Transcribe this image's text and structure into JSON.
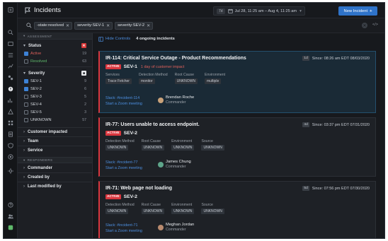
{
  "header": {
    "title": "Incidents",
    "date_badge": "7d",
    "date_range": "Jul 28, 11:25 am – Aug 4, 11:25 am",
    "new_button": "New Incident"
  },
  "search": {
    "query_chips": [
      "-state:resolved",
      "severity:SEV-1",
      "severity:SEV-2"
    ],
    "code_icon_text": "</>"
  },
  "filters": {
    "assessment_header": "ASSESSMENT",
    "status_title": "Status",
    "status_options": [
      {
        "label": "Active",
        "count": "19",
        "checked": true
      },
      {
        "label": "Resolved",
        "count": "63",
        "checked": false
      }
    ],
    "severity_title": "Severity",
    "severity_options": [
      {
        "label": "SEV-1",
        "count": "9",
        "checked": true
      },
      {
        "label": "SEV-2",
        "count": "6",
        "checked": true
      },
      {
        "label": "SEV-3",
        "count": "5",
        "checked": false
      },
      {
        "label": "SEV-4",
        "count": "2",
        "checked": false
      },
      {
        "label": "SEV-5",
        "count": "3",
        "checked": false
      },
      {
        "label": "UNKNOWN",
        "count": "57",
        "checked": false
      }
    ],
    "collapsed_sections": [
      "Customer impacted",
      "Team",
      "Service"
    ],
    "responders_header": "RESPONDERS",
    "responder_sections": [
      "Commander",
      "Created by",
      "Last modified by"
    ]
  },
  "list": {
    "hide_controls": "Hide Controls",
    "count_text": "4 ongoing incidents"
  },
  "incidents": [
    {
      "title": "IR-114: Critical Service Outage - Product Recommendations",
      "age": "1d",
      "since": "Since: 08:26 am EDT 08/03/2020",
      "status": "ACTIVE",
      "severity": "SEV-1",
      "impact": "1 day of customer impact",
      "fields": [
        {
          "label": "Services",
          "value": "Trace Fetcher"
        },
        {
          "label": "Detection Method",
          "value": "monitor"
        },
        {
          "label": "Root Cause",
          "value": "UNKNOWN"
        },
        {
          "label": "Environment",
          "value": "multiple"
        }
      ],
      "slack": "Slack: #incident-114",
      "zoom": "Start a Zoom meeting",
      "commander_name": "Brendan Roche",
      "commander_role": "Commander",
      "avatar_color": "#c9a27a"
    },
    {
      "title": "IR-77: Users unable to access endpoint.",
      "age": "4d",
      "since": "Since: 03:37 pm EDT 07/31/2020",
      "status": "ACTIVE",
      "severity": "SEV-2",
      "impact": "",
      "fields": [
        {
          "label": "Detection Method",
          "value": "UNKNOWN"
        },
        {
          "label": "Root Cause",
          "value": "UNKNOWN"
        },
        {
          "label": "Environment",
          "value": "UNKNOWN"
        },
        {
          "label": "Source",
          "value": "UNKNOWN"
        }
      ],
      "slack": "Slack: #incident-77",
      "zoom": "Start a Zoom meeting",
      "commander_name": "James Chung",
      "commander_role": "Commander",
      "avatar_color": "#5ea58a"
    },
    {
      "title": "IR-71: Web page not loading",
      "age": "5d",
      "since": "Since: 07:56 pm EDT 07/30/2020",
      "status": "ACTIVE",
      "severity": "SEV-2",
      "impact": "",
      "fields": [
        {
          "label": "Detection Method",
          "value": "UNKNOWN"
        },
        {
          "label": "Root Cause",
          "value": "UNKNOWN"
        },
        {
          "label": "Environment",
          "value": "UNKNOWN"
        },
        {
          "label": "Source",
          "value": "UNKNOWN"
        }
      ],
      "slack": "Slack: #incident-71",
      "zoom": "Start a Zoom meeting",
      "commander_name": "Meghan Jordan",
      "commander_role": "Commander",
      "avatar_color": "#b88a6e"
    }
  ],
  "colors": {
    "accent_blue": "#2f73c9",
    "active_red": "#d9363e",
    "background": "#17191d"
  }
}
